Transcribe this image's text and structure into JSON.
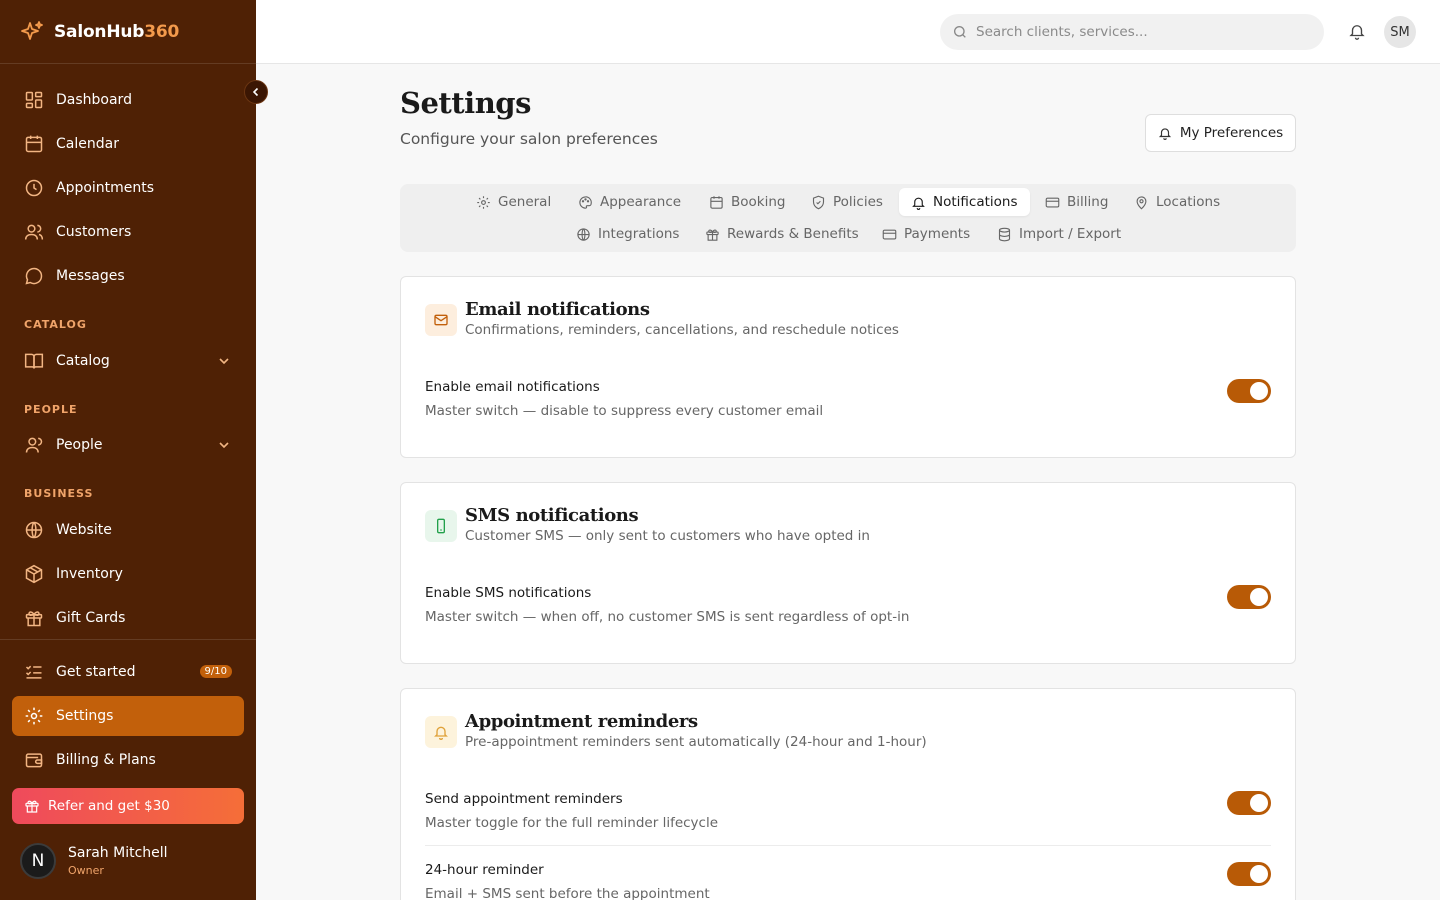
{
  "brand": {
    "name_main": "SalonHub",
    "name_accent": "360"
  },
  "sidebar": {
    "nav": [
      {
        "label": "Dashboard",
        "icon": "grid-icon"
      },
      {
        "label": "Calendar",
        "icon": "calendar-icon"
      },
      {
        "label": "Appointments",
        "icon": "clock-icon"
      },
      {
        "label": "Customers",
        "icon": "users-icon"
      },
      {
        "label": "Messages",
        "icon": "message-icon"
      }
    ],
    "catalog_label": "CATALOG",
    "catalog_item": "Catalog",
    "people_label": "PEOPLE",
    "people_item": "People",
    "business_label": "BUSINESS",
    "business": [
      {
        "label": "Website",
        "icon": "globe-icon"
      },
      {
        "label": "Inventory",
        "icon": "package-icon"
      },
      {
        "label": "Gift Cards",
        "icon": "gift-icon"
      }
    ],
    "get_started": "Get started",
    "get_started_badge": "9/10",
    "settings": "Settings",
    "billing": "Billing & Plans",
    "refer": "Refer and get $30",
    "user": {
      "initial": "N",
      "name": "Sarah Mitchell",
      "role": "Owner"
    }
  },
  "topbar": {
    "search_placeholder": "Search clients, services...",
    "avatar_initials": "SM"
  },
  "page": {
    "title": "Settings",
    "subtitle": "Configure your salon preferences",
    "pref_button": "My Preferences"
  },
  "tabs": {
    "general": "General",
    "appearance": "Appearance",
    "booking": "Booking",
    "policies": "Policies",
    "notifications": "Notifications",
    "billing": "Billing",
    "locations": "Locations",
    "integrations": "Integrations",
    "rewards": "Rewards & Benefits",
    "payments": "Payments",
    "import_export": "Import / Export",
    "active": "notifications"
  },
  "cards": {
    "email": {
      "title": "Email notifications",
      "desc": "Confirmations, reminders, cancellations, and reschedule notices",
      "row_label": "Enable email notifications",
      "row_desc": "Master switch — disable to suppress every customer email",
      "enabled": true
    },
    "sms": {
      "title": "SMS notifications",
      "desc": "Customer SMS — only sent to customers who have opted in",
      "row_label": "Enable SMS notifications",
      "row_desc": "Master switch — when off, no customer SMS is sent regardless of opt-in",
      "enabled": true
    },
    "reminders": {
      "title": "Appointment reminders",
      "desc": "Pre-appointment reminders sent automatically (24-hour and 1-hour)",
      "row1_label": "Send appointment reminders",
      "row1_desc": "Master toggle for the full reminder lifecycle",
      "row1_enabled": true,
      "row2_label": "24-hour reminder",
      "row2_desc": "Email + SMS sent before the appointment",
      "row2_enabled": true
    }
  },
  "colors": {
    "sidebar": "#4f2105",
    "accent": "#c2600b",
    "toggle_on": "#b85a06"
  }
}
